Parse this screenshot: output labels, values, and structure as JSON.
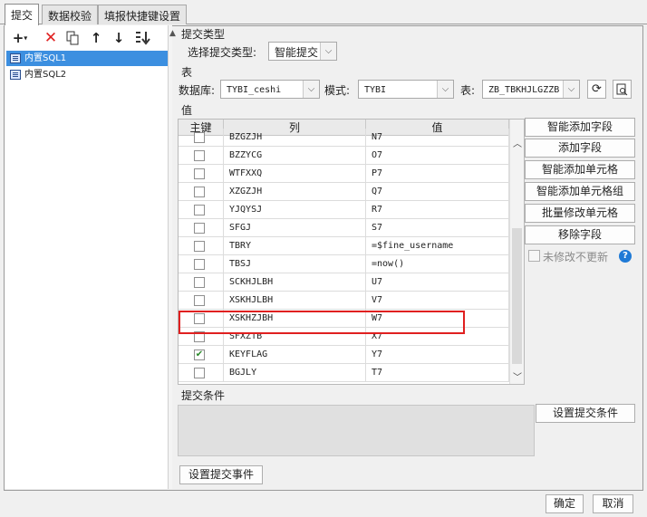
{
  "tabs": [
    {
      "label": "提交",
      "active": true
    },
    {
      "label": "数据校验",
      "active": false
    },
    {
      "label": "填报快捷键设置",
      "active": false
    }
  ],
  "toolbar": {
    "add_icon": "plus-icon",
    "delete_icon": "red-x-icon",
    "copy_icon": "copy-icon",
    "up_icon": "arrow-up-icon",
    "down_icon": "arrow-down-icon",
    "sort_icon": "sort-down-icon"
  },
  "tree": [
    {
      "label": "内置SQL1",
      "selected": true
    },
    {
      "label": "内置SQL2",
      "selected": false
    }
  ],
  "submit_type": {
    "section_label": "提交类型",
    "select_label": "选择提交类型:",
    "value": "智能提交"
  },
  "table_section": {
    "section_label": "表",
    "db_label": "数据库:",
    "db_value": "TYBI_ceshi",
    "schema_label": "模式:",
    "schema_value": "TYBI",
    "table_label": "表:",
    "table_value": "ZB_TBKHJLGZZB"
  },
  "value_section": {
    "section_label": "值",
    "columns": {
      "key": "主键",
      "col": "列",
      "val": "值"
    },
    "rows": [
      {
        "key": false,
        "col": "BZGZJH",
        "val": "N7"
      },
      {
        "key": false,
        "col": "BZZYCG",
        "val": "O7"
      },
      {
        "key": false,
        "col": "WTFXXQ",
        "val": "P7"
      },
      {
        "key": false,
        "col": "XZGZJH",
        "val": "Q7"
      },
      {
        "key": false,
        "col": "YJQYSJ",
        "val": "R7"
      },
      {
        "key": false,
        "col": "SFGJ",
        "val": "S7"
      },
      {
        "key": false,
        "col": "TBRY",
        "val": "=$fine_username"
      },
      {
        "key": false,
        "col": "TBSJ",
        "val": "=now()"
      },
      {
        "key": false,
        "col": "SCKHJLBH",
        "val": "U7"
      },
      {
        "key": false,
        "col": "XSKHJLBH",
        "val": "V7"
      },
      {
        "key": false,
        "col": "XSKHZJBH",
        "val": "W7"
      },
      {
        "key": false,
        "col": "SFXZTB",
        "val": "X7"
      },
      {
        "key": true,
        "col": "KEYFLAG",
        "val": "Y7"
      },
      {
        "key": false,
        "col": "BGJLY",
        "val": "T7"
      }
    ]
  },
  "side_buttons": {
    "smart_add_field": "智能添加字段",
    "add_field": "添加字段",
    "smart_add_cell": "智能添加单元格",
    "smart_add_cell_group": "智能添加单元格组",
    "batch_modify_cell": "批量修改单元格",
    "remove_field": "移除字段",
    "no_update_unchanged": "未修改不更新",
    "help_icon": "question-circle-icon"
  },
  "conditions": {
    "section_label": "提交条件",
    "set_button": "设置提交条件"
  },
  "submit_event_button": "设置提交事件",
  "footer": {
    "ok": "确定",
    "cancel": "取消"
  },
  "colors": {
    "selection": "#3c8fe0",
    "highlight": "#e02020",
    "check": "#2a8a2a"
  }
}
